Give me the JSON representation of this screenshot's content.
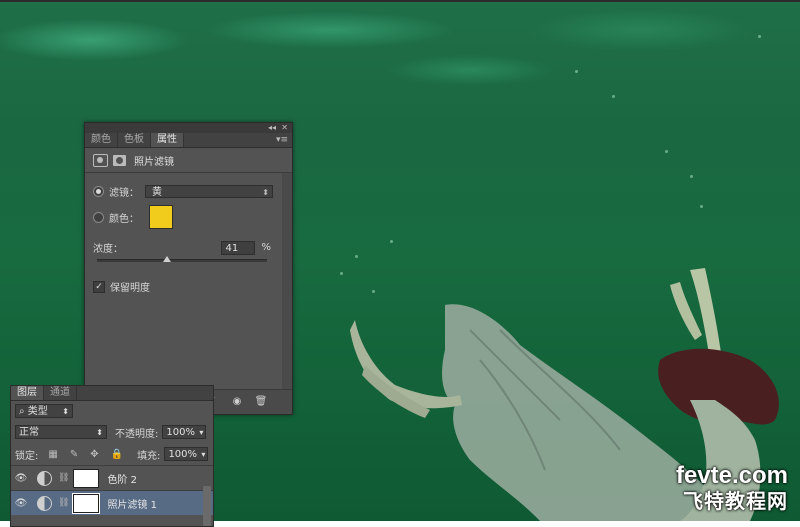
{
  "properties_panel": {
    "tabs": [
      "颜色",
      "色板",
      "属性"
    ],
    "active_tab": "属性",
    "collapse_glyph": "◂◂",
    "close_glyph": "✕",
    "menu_glyph": "▾≡",
    "title": "照片滤镜",
    "filter_label": "滤镜：",
    "filter_value": "黄",
    "color_label": "颜色：",
    "color_value": "#f2cc1c",
    "density_label": "浓度：",
    "density_value": "41",
    "density_unit": "%",
    "density_fraction": 0.41,
    "preserve_luminosity_label": "保留明度",
    "preserve_luminosity_checked": true,
    "footer_icons": [
      "clip-to-layer-icon",
      "view-previous-icon",
      "reset-icon",
      "visibility-icon",
      "delete-icon"
    ]
  },
  "layers_panel": {
    "tabs": [
      "图层",
      "通道"
    ],
    "active_tab": "图层",
    "filter_kind": "类型",
    "blend_mode": "正常",
    "opacity_label": "不透明度:",
    "opacity_value": "100%",
    "lock_label": "锁定:",
    "fill_label": "填充:",
    "fill_value": "100%",
    "layers": [
      {
        "name": "色阶 2",
        "visible": true,
        "selected": false
      },
      {
        "name": "照片滤镜 1",
        "visible": true,
        "selected": true
      }
    ]
  },
  "watermark": {
    "line1": "fevte.com",
    "line2": "飞特教程网"
  },
  "colors": {
    "panel_bg": "#535353",
    "selected_layer": "#586b84",
    "photo_filter_color": "#f2cc1c"
  }
}
